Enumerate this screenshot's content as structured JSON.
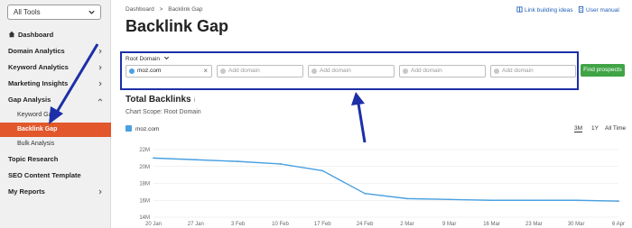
{
  "sidebar": {
    "tools_select": "All Tools",
    "items": [
      {
        "label": "Dashboard"
      },
      {
        "label": "Domain Analytics"
      },
      {
        "label": "Keyword Analytics"
      },
      {
        "label": "Marketing Insights"
      },
      {
        "label": "Gap Analysis"
      },
      {
        "label": "Topic Research"
      },
      {
        "label": "SEO Content Template"
      },
      {
        "label": "My Reports"
      }
    ],
    "gap_sub": [
      {
        "label": "Keyword Gap"
      },
      {
        "label": "Backlink Gap"
      },
      {
        "label": "Bulk Analysis"
      }
    ]
  },
  "breadcrumb": [
    "Dashboard",
    ">",
    "Backlink Gap"
  ],
  "header_links": {
    "ideas": "Link building ideas",
    "manual": "User manual"
  },
  "page_title": "Backlink Gap",
  "compare": {
    "root_domain": "Root Domain",
    "domain1": "moz.com",
    "placeholder": "Add domain",
    "find_button": "Find prospects"
  },
  "section": {
    "title": "Total Backlinks",
    "info": "i",
    "scope": "Chart Scope: Root Domain"
  },
  "legend_label": "moz.com",
  "ranges": [
    "3M",
    "1Y",
    "All Time"
  ],
  "colors": {
    "accent": "#e2572b",
    "line": "#4aa0e0",
    "button": "#3fa446",
    "annotation": "#1c2fa8"
  },
  "chart_data": {
    "type": "line",
    "x": [
      "20 Jan",
      "27 Jan",
      "3 Feb",
      "10 Feb",
      "17 Feb",
      "24 Feb",
      "2 Mar",
      "9 Mar",
      "16 Mar",
      "23 Mar",
      "30 Mar",
      "6 Apr"
    ],
    "yticks": [
      "22M",
      "20M",
      "18M",
      "16M",
      "14M"
    ],
    "ylim": [
      14,
      22
    ],
    "series": [
      {
        "name": "moz.com",
        "values": [
          21.0,
          20.8,
          20.6,
          20.3,
          19.5,
          16.8,
          16.2,
          16.1,
          16.0,
          16.0,
          16.0,
          15.9
        ]
      }
    ]
  }
}
